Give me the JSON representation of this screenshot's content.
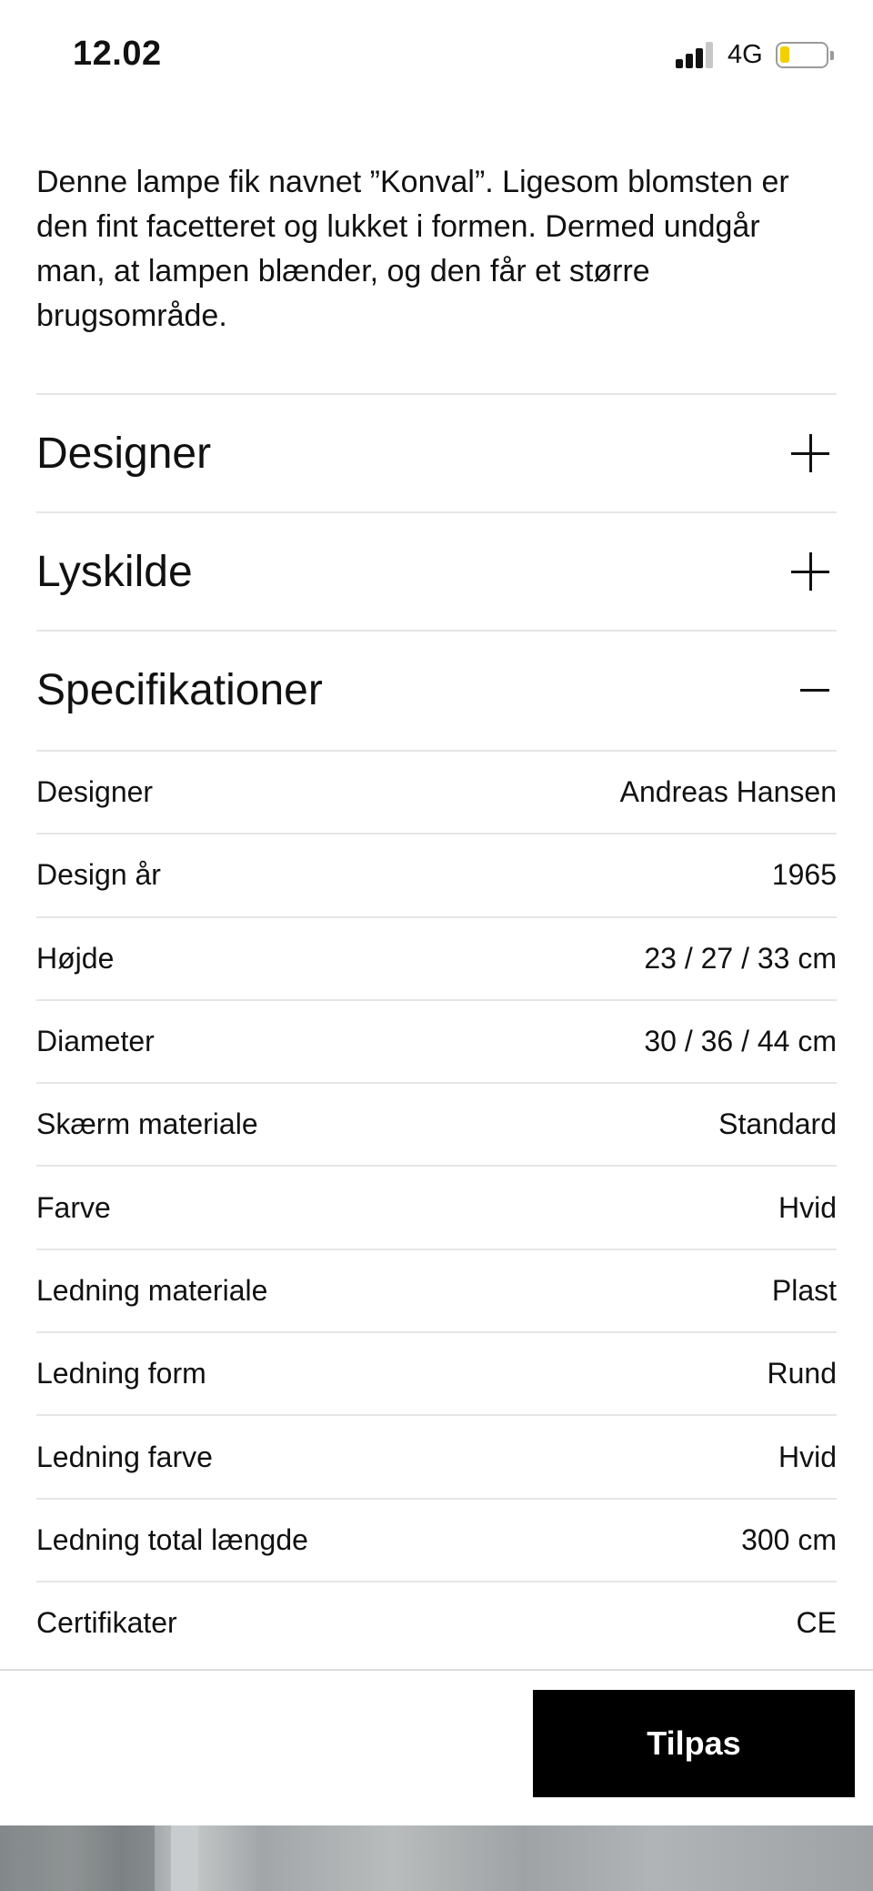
{
  "status_bar": {
    "time": "12.02",
    "network": "4G",
    "battery_level": 0.2,
    "battery_color": "#f4cf00"
  },
  "description": "Denne lampe fik navnet ”Konval”. Ligesom blomsten er den fint facetteret og lukket i formen. Dermed undgår man, at lampen blænder, og den får et større brugsområde.",
  "accordion": {
    "sections": [
      {
        "title": "Designer",
        "state": "collapsed",
        "toggle_icon": "plus-icon"
      },
      {
        "title": "Lyskilde",
        "state": "collapsed",
        "toggle_icon": "plus-icon"
      },
      {
        "title": "Specifikationer",
        "state": "expanded",
        "toggle_icon": "minus-icon"
      }
    ]
  },
  "specifications": [
    {
      "label": "Designer",
      "value": "Andreas Hansen"
    },
    {
      "label": "Design år",
      "value": "1965"
    },
    {
      "label": "Højde",
      "value": "23 / 27 / 33 cm"
    },
    {
      "label": "Diameter",
      "value": "30 / 36 / 44 cm"
    },
    {
      "label": "Skærm materiale",
      "value": "Standard"
    },
    {
      "label": "Farve",
      "value": "Hvid"
    },
    {
      "label": "Ledning materiale",
      "value": "Plast"
    },
    {
      "label": "Ledning form",
      "value": "Rund"
    },
    {
      "label": "Ledning farve",
      "value": "Hvid"
    },
    {
      "label": "Ledning total længde",
      "value": "300 cm"
    },
    {
      "label": "Certifikater",
      "value": "CE"
    }
  ],
  "cta": {
    "label": "Tilpas",
    "background": "#000000",
    "color": "#ffffff"
  }
}
